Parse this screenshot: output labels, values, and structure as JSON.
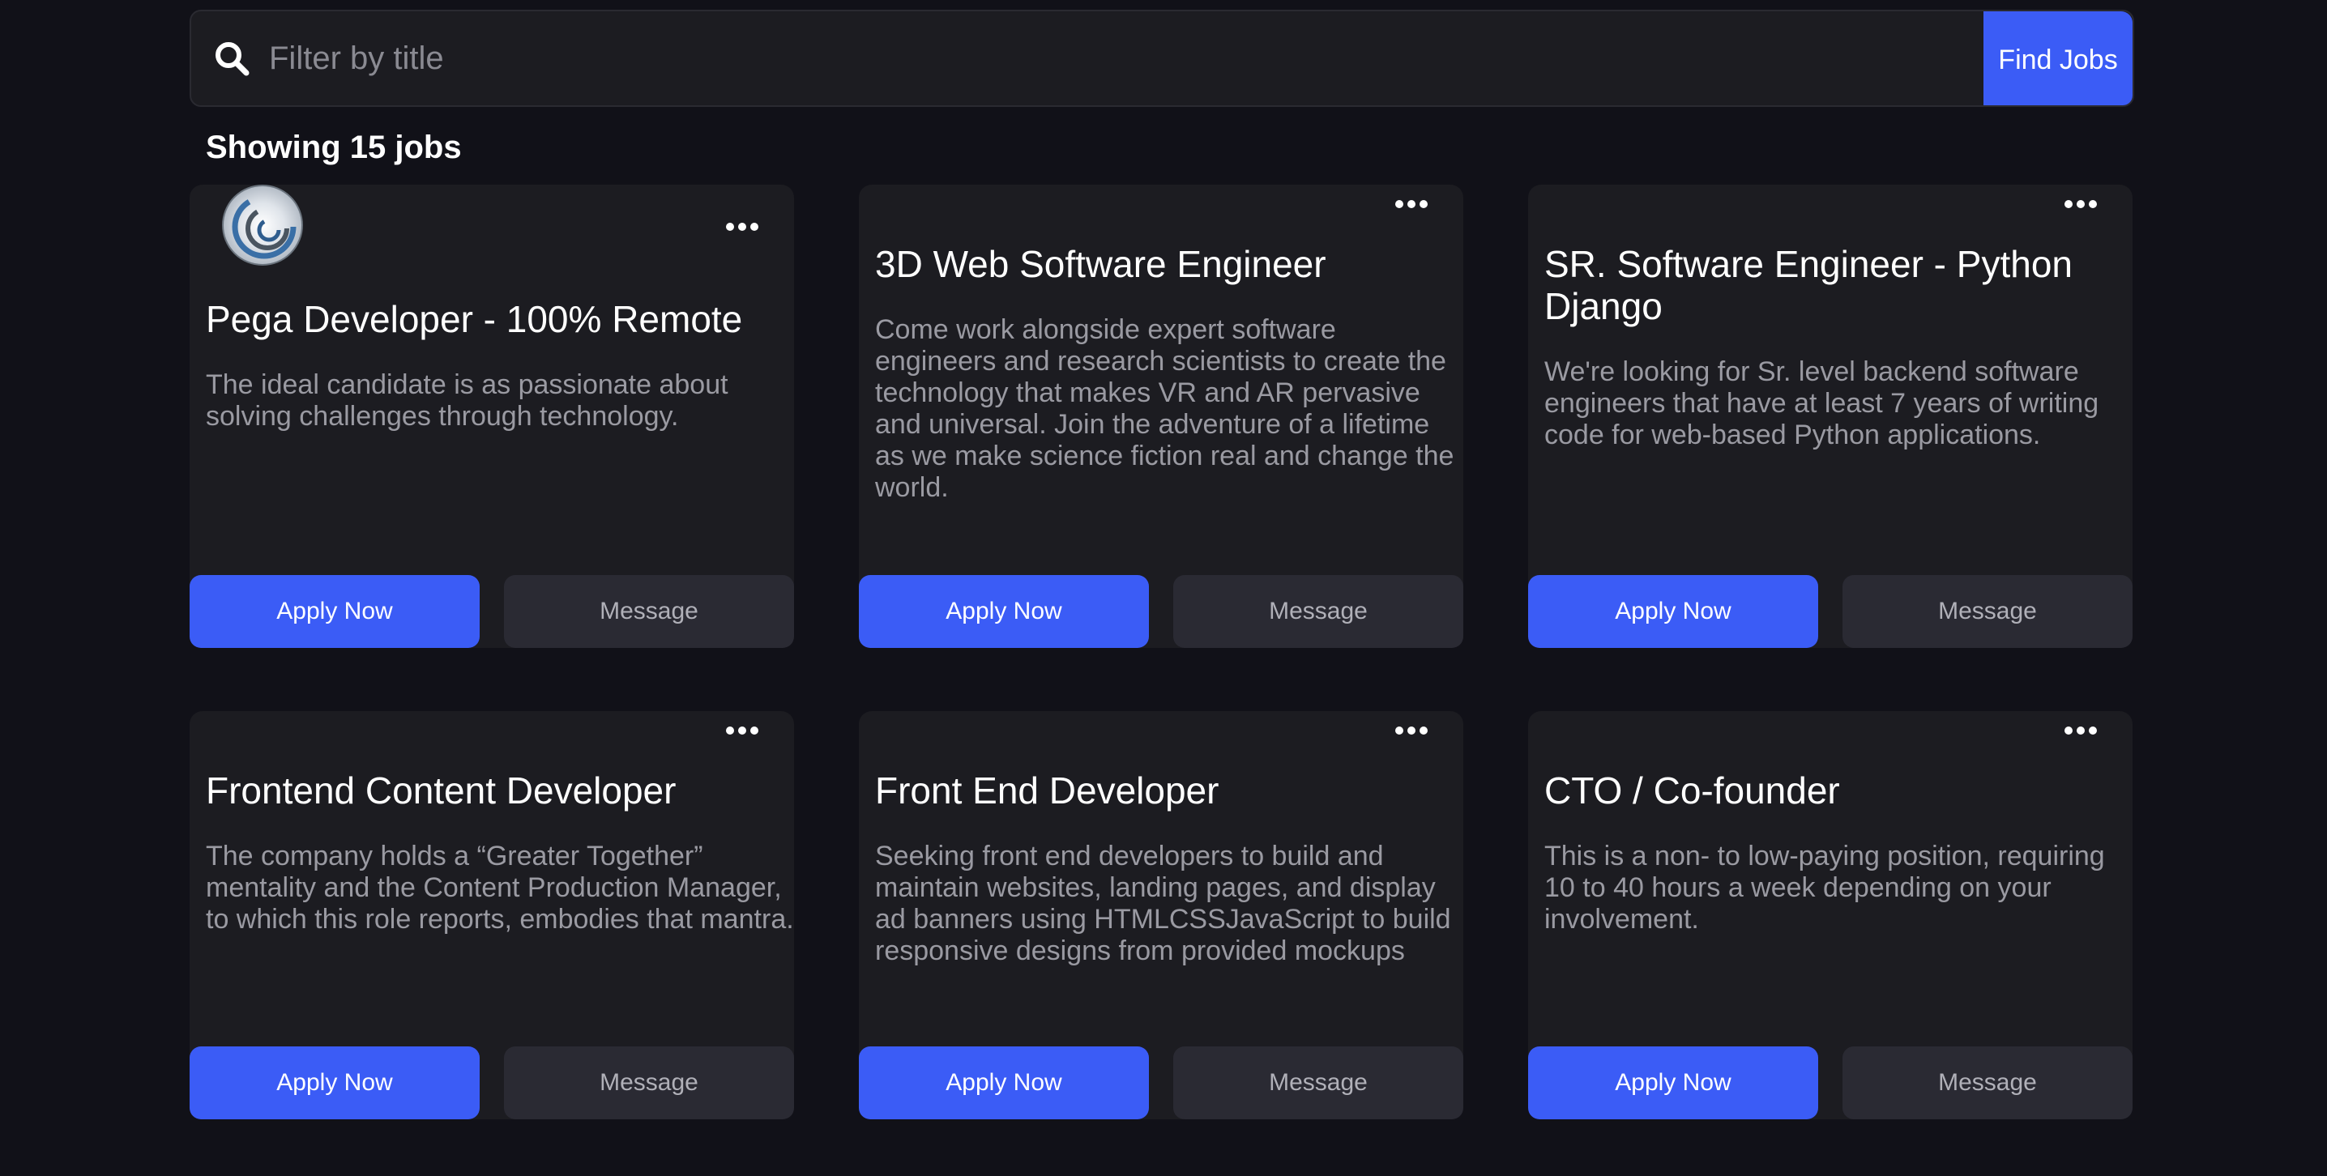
{
  "search": {
    "placeholder": "Filter by title",
    "value": "",
    "button_label": "Find Jobs"
  },
  "results": {
    "count_text": "Showing 15 jobs"
  },
  "jobs": [
    {
      "title": "Pega Developer - 100% Remote",
      "description": "The ideal candidate is as passionate about solving challenges through technology.",
      "apply_label": "Apply Now",
      "message_label": "Message"
    },
    {
      "title": "3D Web Software Engineer",
      "description": "Come work alongside expert software engineers and research scientists to create the technology that makes VR and AR pervasive and universal. Join the adventure of a lifetime as we make science fiction real and change the world.",
      "apply_label": "Apply Now",
      "message_label": "Message"
    },
    {
      "title": "SR. Software Engineer - Python Django",
      "description": "We're looking for Sr. level backend software engineers that have at least 7 years of writing code for web-based Python applications.",
      "apply_label": "Apply Now",
      "message_label": "Message"
    },
    {
      "title": "Frontend Content Developer",
      "description": "The company holds a “Greater Together” mentality and the Content Production Manager, to which this role reports, embodies that mantra.",
      "apply_label": "Apply Now",
      "message_label": "Message"
    },
    {
      "title": "Front End Developer",
      "description": "Seeking front end developers to build and maintain websites, landing pages, and display ad banners using HTMLCSSJavaScript to build responsive designs from provided mockups",
      "apply_label": "Apply Now",
      "message_label": "Message"
    },
    {
      "title": "CTO / Co-founder",
      "description": "This is a non- to low-paying position, requiring 10 to 40 hours a week depending on your involvement.",
      "apply_label": "Apply Now",
      "message_label": "Message"
    }
  ],
  "theme": {
    "background": "#111118",
    "card": "#1c1c21",
    "accent": "#3b5cf6",
    "secondary_button": "#2a2a33"
  }
}
